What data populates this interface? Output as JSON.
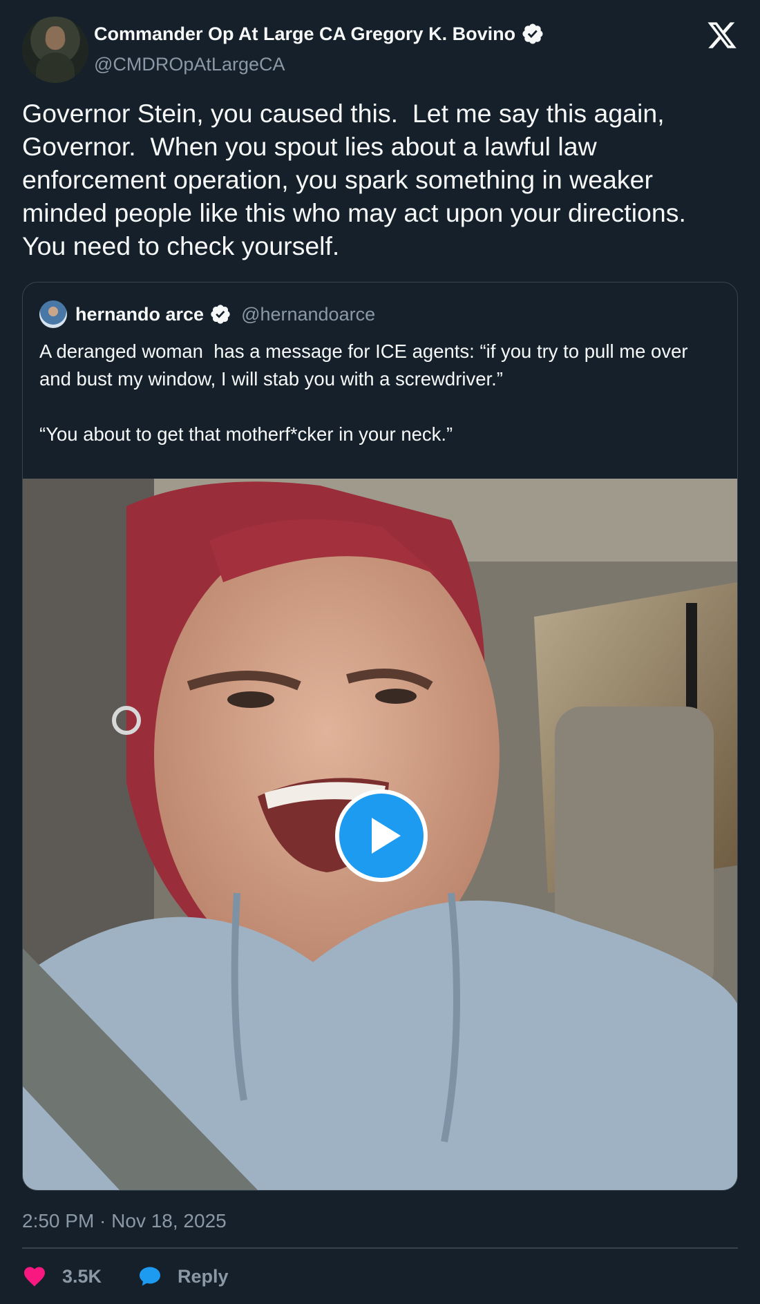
{
  "author": {
    "display_name": "Commander Op At Large CA Gregory K. Bovino",
    "handle": "@CMDROpAtLargeCA",
    "verified": true
  },
  "tweet": {
    "text": "Governor Stein, you caused this.  Let me say this again, Governor.  When you spout lies about a lawful law enforcement operation, you spark something in weaker minded people like this who may act upon your directions.  You need to check yourself."
  },
  "quoted_tweet": {
    "display_name": "hernando arce",
    "handle": "@hernandoarce",
    "verified": true,
    "text": "A deranged woman  has a message for ICE agents: “if you try to pull me over and bust my window, I will stab you with a screwdriver.”\n\n“You about to get that motherf*cker in your neck.”",
    "media": {
      "type": "video",
      "icon": "play-icon"
    }
  },
  "meta": {
    "timestamp": "2:50 PM · Nov 18, 2025"
  },
  "actions": {
    "like_count": "3.5K",
    "reply_label": "Reply"
  },
  "colors": {
    "background": "#15202b",
    "accent": "#1d9bf0",
    "like": "#f91880",
    "muted_text": "#8b98a5",
    "border": "#38444d"
  }
}
